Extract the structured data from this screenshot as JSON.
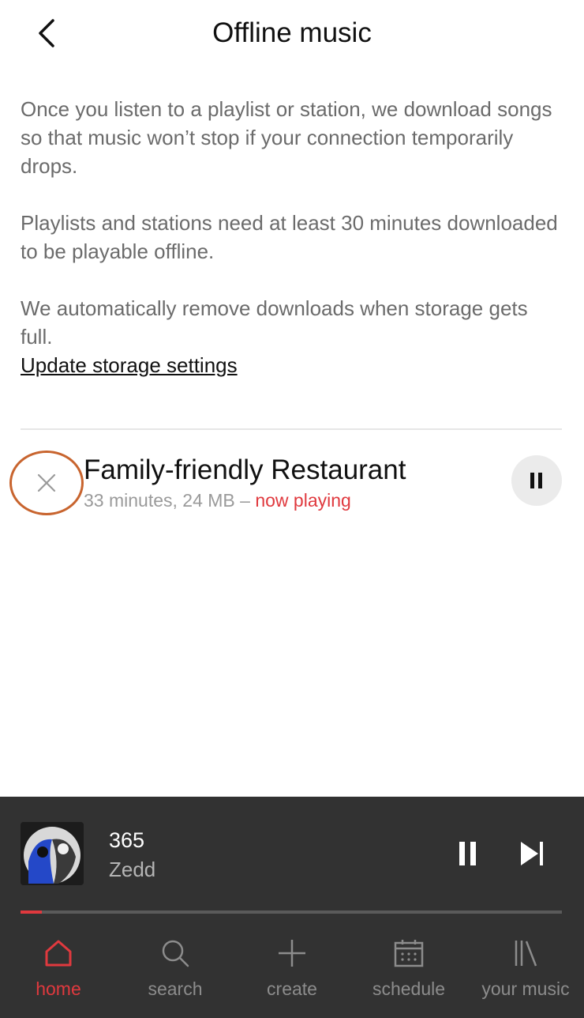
{
  "header": {
    "title": "Offline music"
  },
  "info": {
    "paragraphs": [
      "Once you listen to a playlist or station, we download songs so that music won’t stop if your connection temporarily drops.",
      "Playlists and stations need at least 30 minutes downloaded to be playable offline.",
      "We automatically remove downloads when storage gets full."
    ],
    "storage_link": "Update storage settings"
  },
  "download": {
    "title": "Family-friendly Restaurant",
    "details": "33 minutes, 24 MB – ",
    "status": "now playing"
  },
  "player": {
    "track_title": "365",
    "artist": "Zedd",
    "progress": 0.04
  },
  "nav": {
    "items": [
      {
        "label": "home",
        "icon": "home-icon",
        "active": true
      },
      {
        "label": "search",
        "icon": "search-icon",
        "active": false
      },
      {
        "label": "create",
        "icon": "plus-icon",
        "active": false
      },
      {
        "label": "schedule",
        "icon": "calendar-icon",
        "active": false
      },
      {
        "label": "your music",
        "icon": "library-icon",
        "active": false
      }
    ]
  },
  "colors": {
    "accent": "#e0393e",
    "highlight_ring": "#c8642e",
    "player_bg": "#323232"
  }
}
